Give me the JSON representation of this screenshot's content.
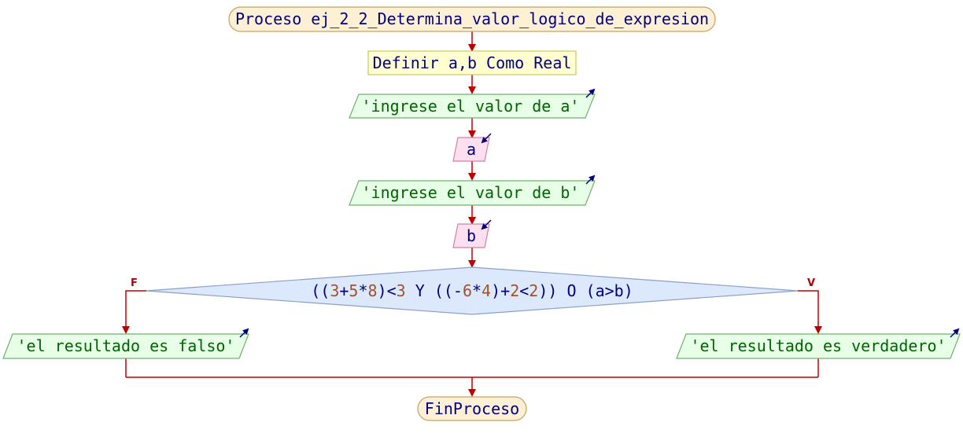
{
  "diagram": {
    "start": {
      "keyword": "Proceso",
      "name": "ej_2_2_Determina_valor_logico_de_expresion"
    },
    "define": {
      "text": "Definir a,b Como Real"
    },
    "output_a": {
      "text": "'ingrese el valor de a'"
    },
    "input_a": {
      "text": "a"
    },
    "output_b": {
      "text": "'ingrese el valor de b'"
    },
    "input_b": {
      "text": "b"
    },
    "decision": {
      "tokens": [
        {
          "t": "((",
          "c": "kw"
        },
        {
          "t": "3",
          "c": "num"
        },
        {
          "t": "+",
          "c": "kw"
        },
        {
          "t": "5",
          "c": "num"
        },
        {
          "t": "*",
          "c": "kw"
        },
        {
          "t": "8",
          "c": "num"
        },
        {
          "t": ")<",
          "c": "kw"
        },
        {
          "t": "3",
          "c": "num"
        },
        {
          "t": " Y ((-",
          "c": "kw"
        },
        {
          "t": "6",
          "c": "num"
        },
        {
          "t": "*",
          "c": "kw"
        },
        {
          "t": "4",
          "c": "num"
        },
        {
          "t": ")+",
          "c": "kw"
        },
        {
          "t": "2",
          "c": "num"
        },
        {
          "t": "<",
          "c": "kw"
        },
        {
          "t": "2",
          "c": "num"
        },
        {
          "t": ")) O (a>b)",
          "c": "kw"
        }
      ],
      "false_label": "F",
      "true_label": "V"
    },
    "output_false": {
      "text": "'el resultado es falso'"
    },
    "output_true": {
      "text": "'el resultado es verdadero'"
    },
    "end": {
      "text": "FinProceso"
    },
    "colors": {
      "terminal_fill": "#fdf0d5",
      "terminal_stroke": "#c8a060",
      "define_fill": "#ffffd0",
      "define_stroke": "#c8c860",
      "output_fill": "#e6ffe6",
      "output_stroke": "#70b070",
      "input_fill": "#fde0f0",
      "input_stroke": "#d080a8",
      "decision_fill": "#dce8fc",
      "decision_stroke": "#8aa0c8",
      "arrow": "#c00000",
      "io_icon": "#000080"
    }
  }
}
